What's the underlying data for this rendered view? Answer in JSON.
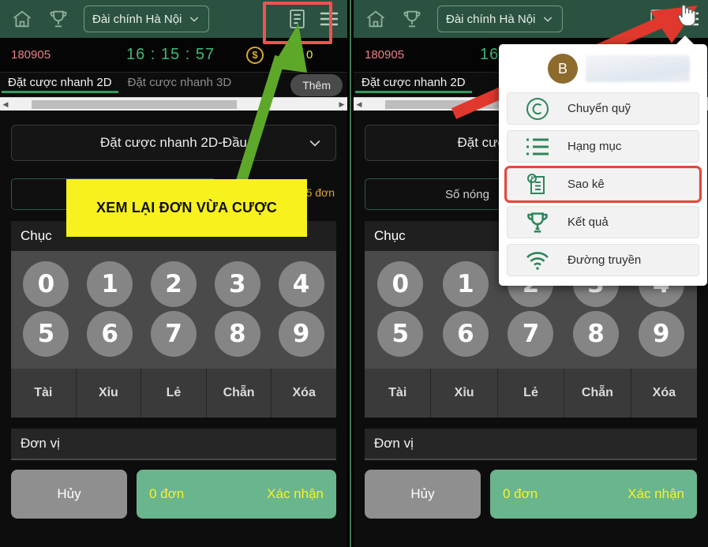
{
  "header": {
    "home_icon": "home-icon",
    "trophy_icon": "trophy-icon",
    "station_label": "Đài chính Hà Nội",
    "chevron_icon": "chevron-down-icon",
    "document_icon": "document-icon",
    "menu_icon": "hamburger-menu-icon",
    "bg_color": "#2b5240"
  },
  "infobar": {
    "issue": "180905",
    "clock": "16 : 15 : 57",
    "coin_icon": "dollar-coin-icon",
    "coin_symbol": "$",
    "balance": "0",
    "issue_color": "#e9808a",
    "clock_color": "#3fb873",
    "balance_color": "#e6e43c"
  },
  "tabs": {
    "items": [
      {
        "label": "Đặt cược nhanh 2D",
        "active": true
      },
      {
        "label": "Đặt cược nhanh 3D",
        "active": false
      }
    ],
    "more_label": "Thêm",
    "scroll_left_icon": "triangle-left-icon",
    "scroll_right_icon": "triangle-right-icon"
  },
  "bet": {
    "mode_label": "Đặt cược nhanh 2D-Đầu",
    "mode_chevron_icon": "chevron-down-icon",
    "hot_number_label": "Số nóng",
    "order_count_label": "65 đơn",
    "order_count_color": "#d8a730"
  },
  "keypad": {
    "group_label": "Chục",
    "rows": [
      [
        "0",
        "1",
        "2",
        "3",
        "4"
      ],
      [
        "5",
        "6",
        "7",
        "8",
        "9"
      ]
    ],
    "functions": [
      "Tài",
      "Xỉu",
      "Lẻ",
      "Chẵn",
      "Xóa"
    ]
  },
  "footer": {
    "unit_label": "Đơn vị",
    "cancel_label": "Hủy",
    "order_summary": "0 đơn",
    "confirm_label": "Xác nhận",
    "confirm_bg": "#69b58d",
    "confirm_text_color": "#f6f32a",
    "cancel_bg": "#8f8f8f"
  },
  "popup": {
    "avatar_initial": "B",
    "items": [
      {
        "label": "Chuyển quỹ",
        "icon": "copyright-circle-icon",
        "highlighted": false
      },
      {
        "label": "Hạng mục",
        "icon": "list-icon",
        "highlighted": false
      },
      {
        "label": "Sao kê",
        "icon": "statement-clock-icon",
        "highlighted": true
      },
      {
        "label": "Kết quả",
        "icon": "trophy-icon",
        "highlighted": false
      },
      {
        "label": "Đường truyền",
        "icon": "wifi-icon",
        "highlighted": false
      }
    ],
    "accent_color": "#2d8659",
    "highlight_color": "#e8453c"
  },
  "annotations": {
    "note_text": "XEM LẠI ĐƠN VỪA CƯỢC",
    "note_bg": "#f7f11e",
    "green_arrow_color": "#5ea829",
    "red_arrow_color": "#e0382c",
    "highlight_border_color": "#ef5350",
    "cursor_icon": "hand-pointer-icon"
  }
}
